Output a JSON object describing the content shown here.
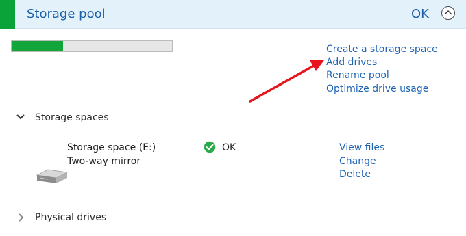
{
  "header": {
    "title": "Storage pool",
    "status": "OK",
    "accent_color": "#0aa33a",
    "collapse_icon": "chevron-up-icon"
  },
  "capacity": {
    "used_fraction": 0.32,
    "fill_color": "#12a53a"
  },
  "pool_actions": [
    {
      "label": "Create a storage space"
    },
    {
      "label": "Add drives"
    },
    {
      "label": "Rename pool"
    },
    {
      "label": "Optimize drive usage"
    }
  ],
  "annotation": {
    "type": "arrow",
    "color": "#e8141b",
    "points_to": "Add drives"
  },
  "storage_spaces": {
    "section_label": "Storage spaces",
    "expanded": true,
    "space": {
      "name": "Storage space (E:)",
      "resiliency": "Two-way mirror",
      "status": "OK",
      "status_icon": "check-circle-icon",
      "drive_icon": "drive-icon",
      "actions": [
        {
          "label": "View files"
        },
        {
          "label": "Change"
        },
        {
          "label": "Delete"
        }
      ]
    }
  },
  "physical_drives": {
    "section_label": "Physical drives",
    "expanded": false
  }
}
